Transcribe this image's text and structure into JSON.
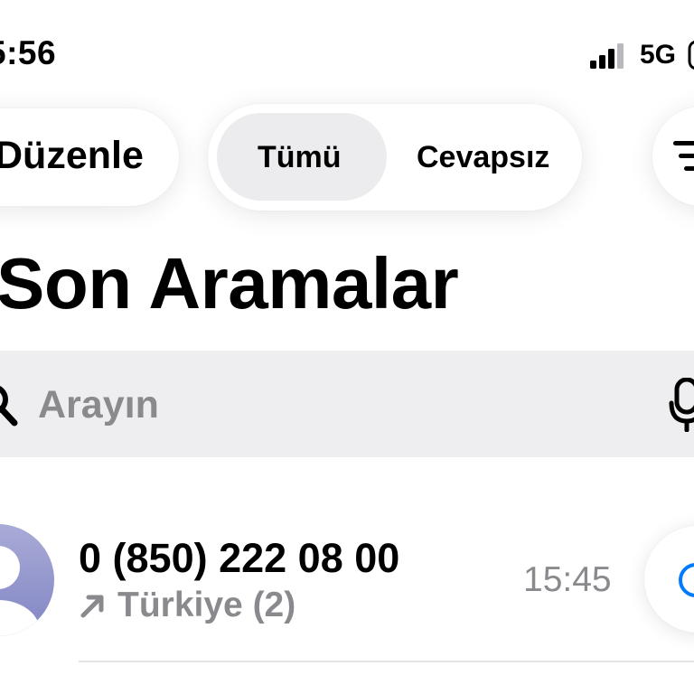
{
  "status_bar": {
    "time": "5:56",
    "network": "5G"
  },
  "top_bar": {
    "edit_label": "Düzenle",
    "segments": [
      "Tümü",
      "Cevapsız"
    ],
    "selected_segment": "Tümü",
    "filter_icon": "filter-icon"
  },
  "title": "Son Aramalar",
  "search": {
    "placeholder": "Arayın",
    "value": "",
    "icon": "search-icon",
    "mic_icon": "mic-icon"
  },
  "recents": [
    {
      "number": "0 (850) 222 08 00",
      "subtitle": "Türkiye (2)",
      "direction_icon": "outgoing-arrow-icon",
      "time": "15:45",
      "action_icon": "info-icon"
    }
  ],
  "colors": {
    "accent": "#007aff",
    "secondary_text": "#8a8a8e",
    "search_background": "#eeeef0",
    "segment_selected": "#ececee"
  }
}
